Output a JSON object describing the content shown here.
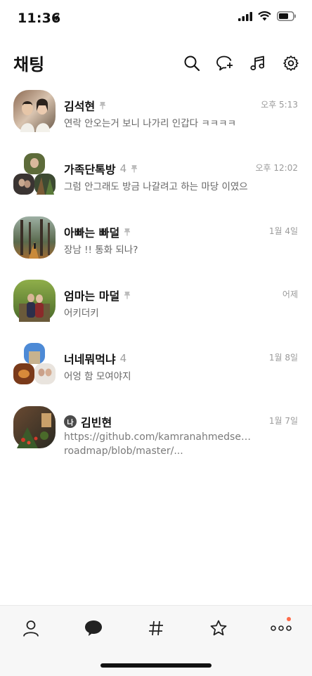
{
  "status": {
    "time": "11:36"
  },
  "header": {
    "title": "채팅"
  },
  "chats": [
    {
      "name": "김석현",
      "count": "",
      "time": "오후 5:13",
      "message": "연락 안오는거 보니 나가리 인갑다 ㅋㅋㅋㅋ",
      "pinned": true
    },
    {
      "name": "가족단톡방",
      "count": "4",
      "time": "오후 12:02",
      "message": "그럼 안그래도 방금 나갈려고 하는 마당 이였으",
      "pinned": true
    },
    {
      "name": "아빠는 빠덜",
      "count": "",
      "time": "1월 4일",
      "message": "장남 !! 통화 되나?",
      "pinned": true
    },
    {
      "name": "엄마는 마덜",
      "count": "",
      "time": "어제",
      "message": "어키더키",
      "pinned": true
    },
    {
      "name": "너네뭐먹냐",
      "count": "4",
      "time": "1월 8일",
      "message": "어엉 함 모여야지",
      "pinned": false
    },
    {
      "name": "김빈현",
      "badge": "나",
      "count": "",
      "time": "1월 7일",
      "message": "https://github.com/kamranahmedse/developer-roadmap/blob/master/...",
      "pinned": false
    }
  ],
  "colors": {
    "accent": "#ff6b4a",
    "tabbar": "#f7f7f7"
  },
  "icons": [
    "search-icon",
    "new-chat-icon",
    "music-icon",
    "settings-icon",
    "friends-icon",
    "chat-icon",
    "hashtag-icon",
    "star-icon",
    "more-icon"
  ]
}
